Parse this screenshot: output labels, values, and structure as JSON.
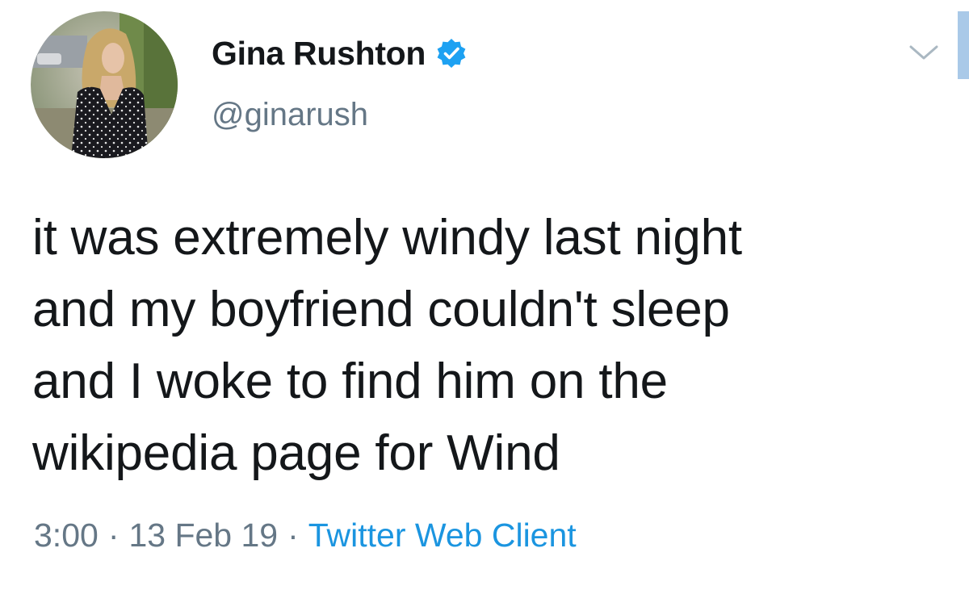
{
  "tweet": {
    "author": {
      "display_name": "Gina Rushton",
      "handle": "@ginarush",
      "verified": true,
      "avatar_icon": "profile-photo"
    },
    "text_lines": [
      "it was extremely windy last night",
      "and my boyfriend couldn't sleep",
      "and I woke to find him on the",
      "wikipedia page for Wind"
    ],
    "time": "3:00",
    "separator": "·",
    "date": "13 Feb 19",
    "client": "Twitter Web Client",
    "menu_icon": "chevron-down-icon"
  },
  "colors": {
    "text": "#14171a",
    "secondary": "#657786",
    "accent": "#1b95e0",
    "verified": "#1da1f2"
  }
}
